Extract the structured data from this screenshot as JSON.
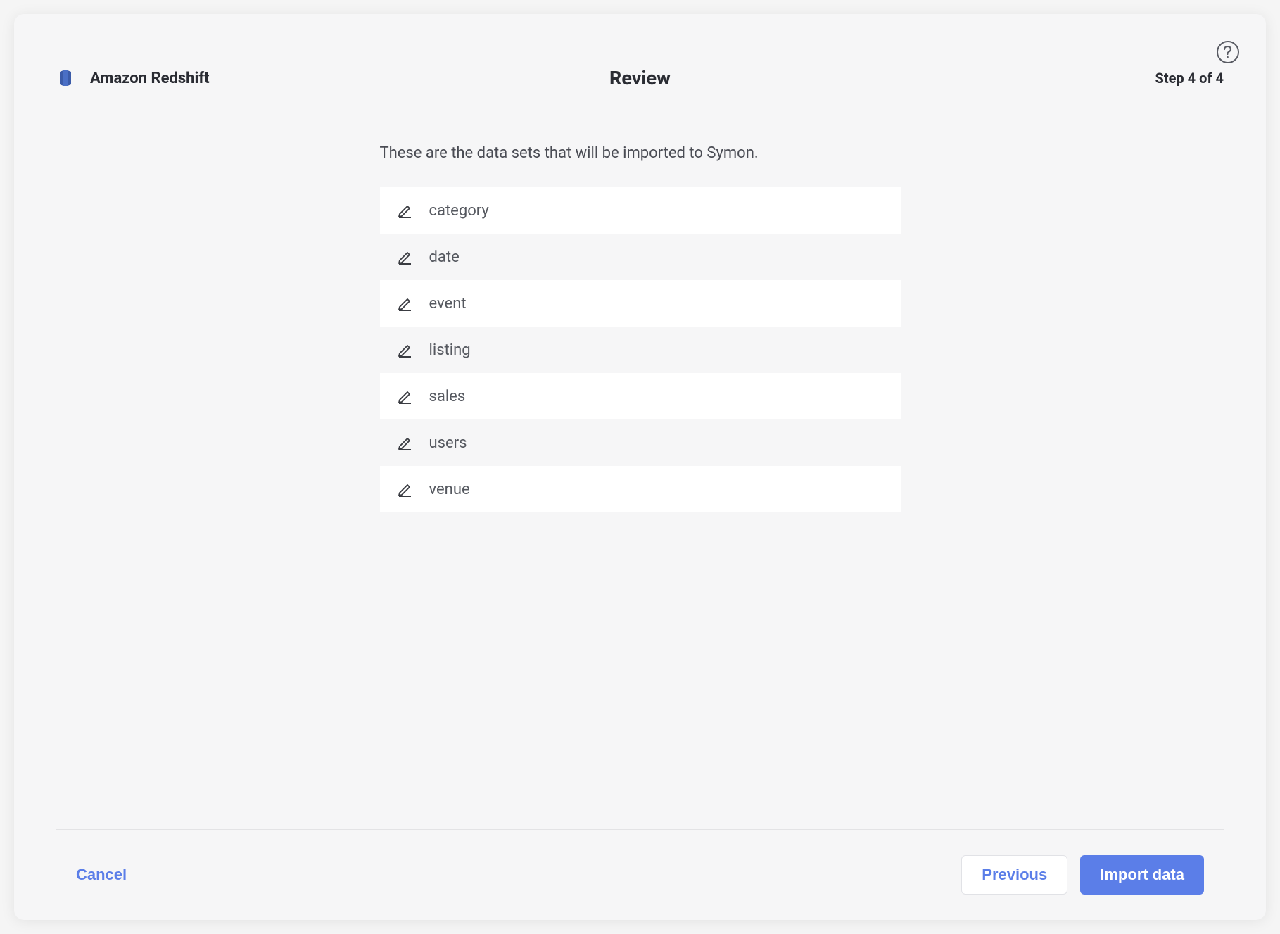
{
  "header": {
    "source_name": "Amazon Redshift",
    "title": "Review",
    "step_indicator": "Step 4 of 4"
  },
  "content": {
    "intro_text": "These are the data sets that will be imported to Symon.",
    "datasets": [
      {
        "name": "category"
      },
      {
        "name": "date"
      },
      {
        "name": "event"
      },
      {
        "name": "listing"
      },
      {
        "name": "sales"
      },
      {
        "name": "users"
      },
      {
        "name": "venue"
      }
    ]
  },
  "footer": {
    "cancel_label": "Cancel",
    "previous_label": "Previous",
    "import_label": "Import data"
  }
}
